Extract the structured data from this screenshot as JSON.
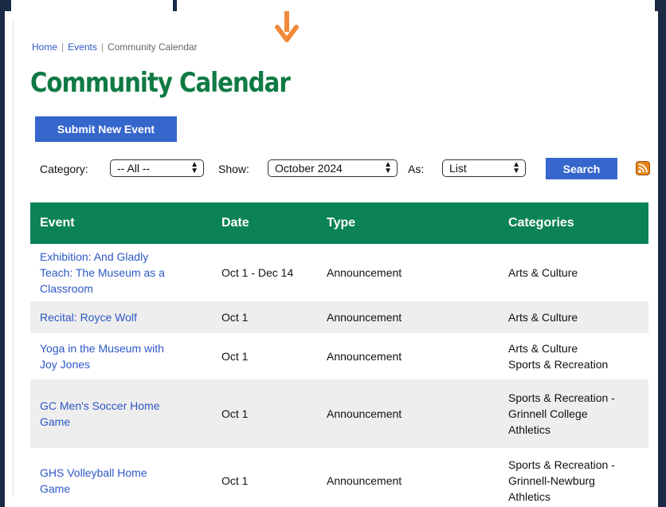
{
  "breadcrumb": {
    "home": "Home",
    "events": "Events",
    "current": "Community Calendar"
  },
  "page_title": "Community Calendar",
  "submit_button": "Submit New Event",
  "filters": {
    "category_label": "Category:",
    "category_value": "-- All --",
    "show_label": "Show:",
    "show_value": "October 2024",
    "as_label": "As:",
    "as_value": "List",
    "search_button": "Search"
  },
  "table": {
    "headers": [
      "Event",
      "Date",
      "Type",
      "Categories"
    ],
    "rows": [
      {
        "event_lines": [
          "Exhibition: And Gladly",
          "Teach: The Museum as a",
          "Classroom"
        ],
        "date": "Oct 1 - Dec 14",
        "type": "Announcement",
        "categories": [
          "Arts & Culture"
        ]
      },
      {
        "event_lines": [
          "Recital: Royce Wolf"
        ],
        "date": "Oct 1",
        "type": "Announcement",
        "categories": [
          "Arts & Culture"
        ]
      },
      {
        "event_lines": [
          "Yoga in the Museum with",
          "Joy Jones"
        ],
        "date": "Oct 1",
        "type": "Announcement",
        "categories": [
          "Arts & Culture",
          "Sports & Recreation"
        ]
      },
      {
        "event_lines": [
          "GC Men's Soccer Home",
          "Game"
        ],
        "date": "Oct 1",
        "type": "Announcement",
        "categories": [
          "Sports & Recreation -",
          "Grinnell College",
          "Athletics"
        ]
      },
      {
        "event_lines": [
          "GHS Volleyball Home",
          "Game"
        ],
        "date": "Oct 1",
        "type": "Announcement",
        "categories": [
          "Sports & Recreation -",
          "Grinnell-Newburg",
          "Athletics"
        ]
      }
    ]
  },
  "icons": {
    "arrow": "down-arrow-icon",
    "rss": "rss-feed-icon",
    "caret": "select-caret-icon"
  },
  "colors": {
    "brand_green": "#0c8356",
    "button_blue": "#3566cc",
    "link_blue": "#2d57c6",
    "arrow_orange": "#f08a3a"
  }
}
